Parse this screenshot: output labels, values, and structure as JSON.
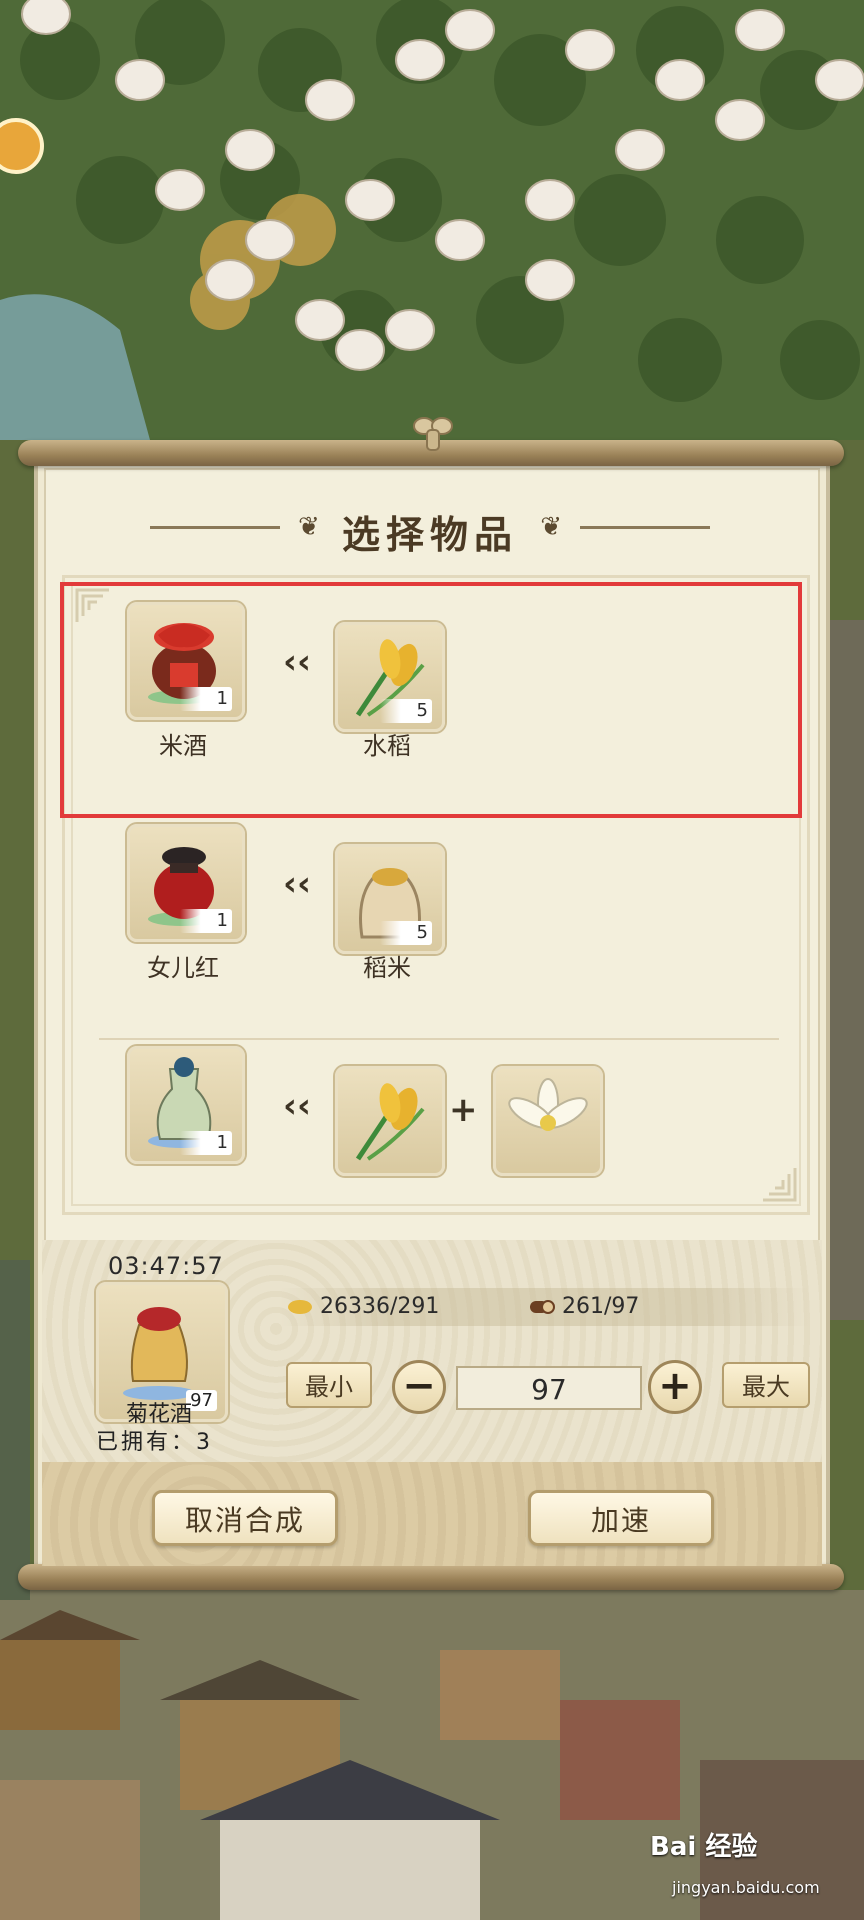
{
  "panel": {
    "title": "选择物品"
  },
  "recipes": [
    {
      "product": {
        "name": "米酒",
        "count": "1",
        "icon": "rice-wine-jar-icon"
      },
      "ingredients": [
        {
          "name": "水稻",
          "count": "5",
          "icon": "rice-plant-icon"
        }
      ]
    },
    {
      "product": {
        "name": "女儿红",
        "count": "1",
        "icon": "nuerhong-wine-jar-icon"
      },
      "ingredients": [
        {
          "name": "稻米",
          "count": "5",
          "icon": "rice-sack-icon"
        }
      ]
    },
    {
      "product": {
        "name": "",
        "count": "1",
        "icon": "chrysanthemum-wine-bottle-icon"
      },
      "ingredients": [
        {
          "name": "",
          "count": "",
          "icon": "rice-plant-icon"
        },
        {
          "name": "",
          "count": "",
          "icon": "white-flower-icon"
        }
      ]
    }
  ],
  "crafting": {
    "timer": "03:47:57",
    "product_name": "菊花酒",
    "product_count": "97",
    "owned_label": "已拥有：3",
    "resource1": {
      "icon": "grain-icon",
      "value": "26336/291"
    },
    "resource2": {
      "icon": "wood-log-icon",
      "value": "261/97"
    },
    "min_label": "最小",
    "max_label": "最大",
    "minus_label": "−",
    "plus_label": "+",
    "quantity": "97"
  },
  "footer": {
    "cancel_label": "取消合成",
    "speed_label": "加速"
  },
  "watermark": {
    "brand": "Bai 经验",
    "url": "jingyan.baidu.com"
  },
  "colors": {
    "highlight": "#e23a3a",
    "paper": "#f3efdc",
    "button": "#e8d8ae"
  }
}
